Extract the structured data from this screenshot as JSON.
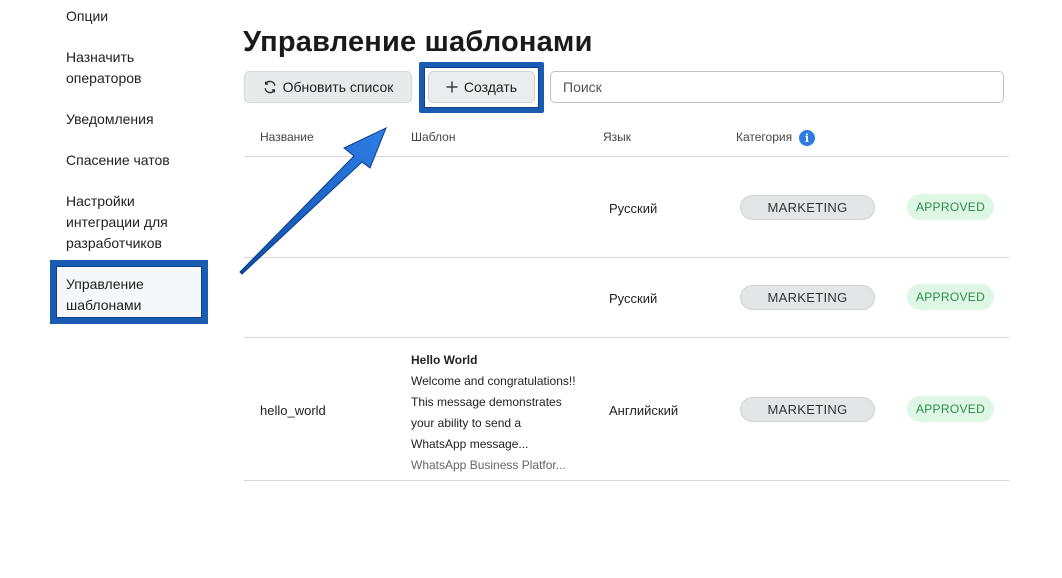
{
  "sidebar": {
    "items": [
      {
        "label": "Опции"
      },
      {
        "label": "Назначить операторов"
      },
      {
        "label": "Уведомления"
      },
      {
        "label": "Спасение чатов"
      },
      {
        "label": "Настройки интеграции для разработчиков"
      },
      {
        "label": "Управление шаблонами",
        "active": true
      }
    ]
  },
  "page": {
    "title": "Управление шаблонами"
  },
  "toolbar": {
    "refresh_label": "Обновить список",
    "create_label": "Создать",
    "search_placeholder": "Поиск"
  },
  "table": {
    "columns": [
      "Название",
      "Шаблон",
      "Язык",
      "Категория"
    ],
    "rows": [
      {
        "name": "",
        "template": "",
        "language": "Русский",
        "category": "MARKETING",
        "status": "APPROVED"
      },
      {
        "name": "",
        "template": "",
        "language": "Русский",
        "category": "MARKETING",
        "status": "APPROVED"
      },
      {
        "name": "hello_world",
        "template": {
          "title": "Hello World",
          "body_lines": [
            "Welcome and congratulations!!",
            "This message demonstrates",
            "your ability to send a",
            "WhatsApp message..."
          ],
          "footer": "WhatsApp Business Platfor..."
        },
        "language": "Английский",
        "category": "MARKETING",
        "status": "APPROVED"
      }
    ]
  },
  "colors": {
    "highlight": "#1a5cb4",
    "info": "#2d7be5",
    "status_bg": "#ddf7e4",
    "status_text": "#2e8a4c"
  },
  "icons": {
    "refresh": "refresh-icon",
    "create": "plus-icon",
    "info": "info-icon"
  }
}
